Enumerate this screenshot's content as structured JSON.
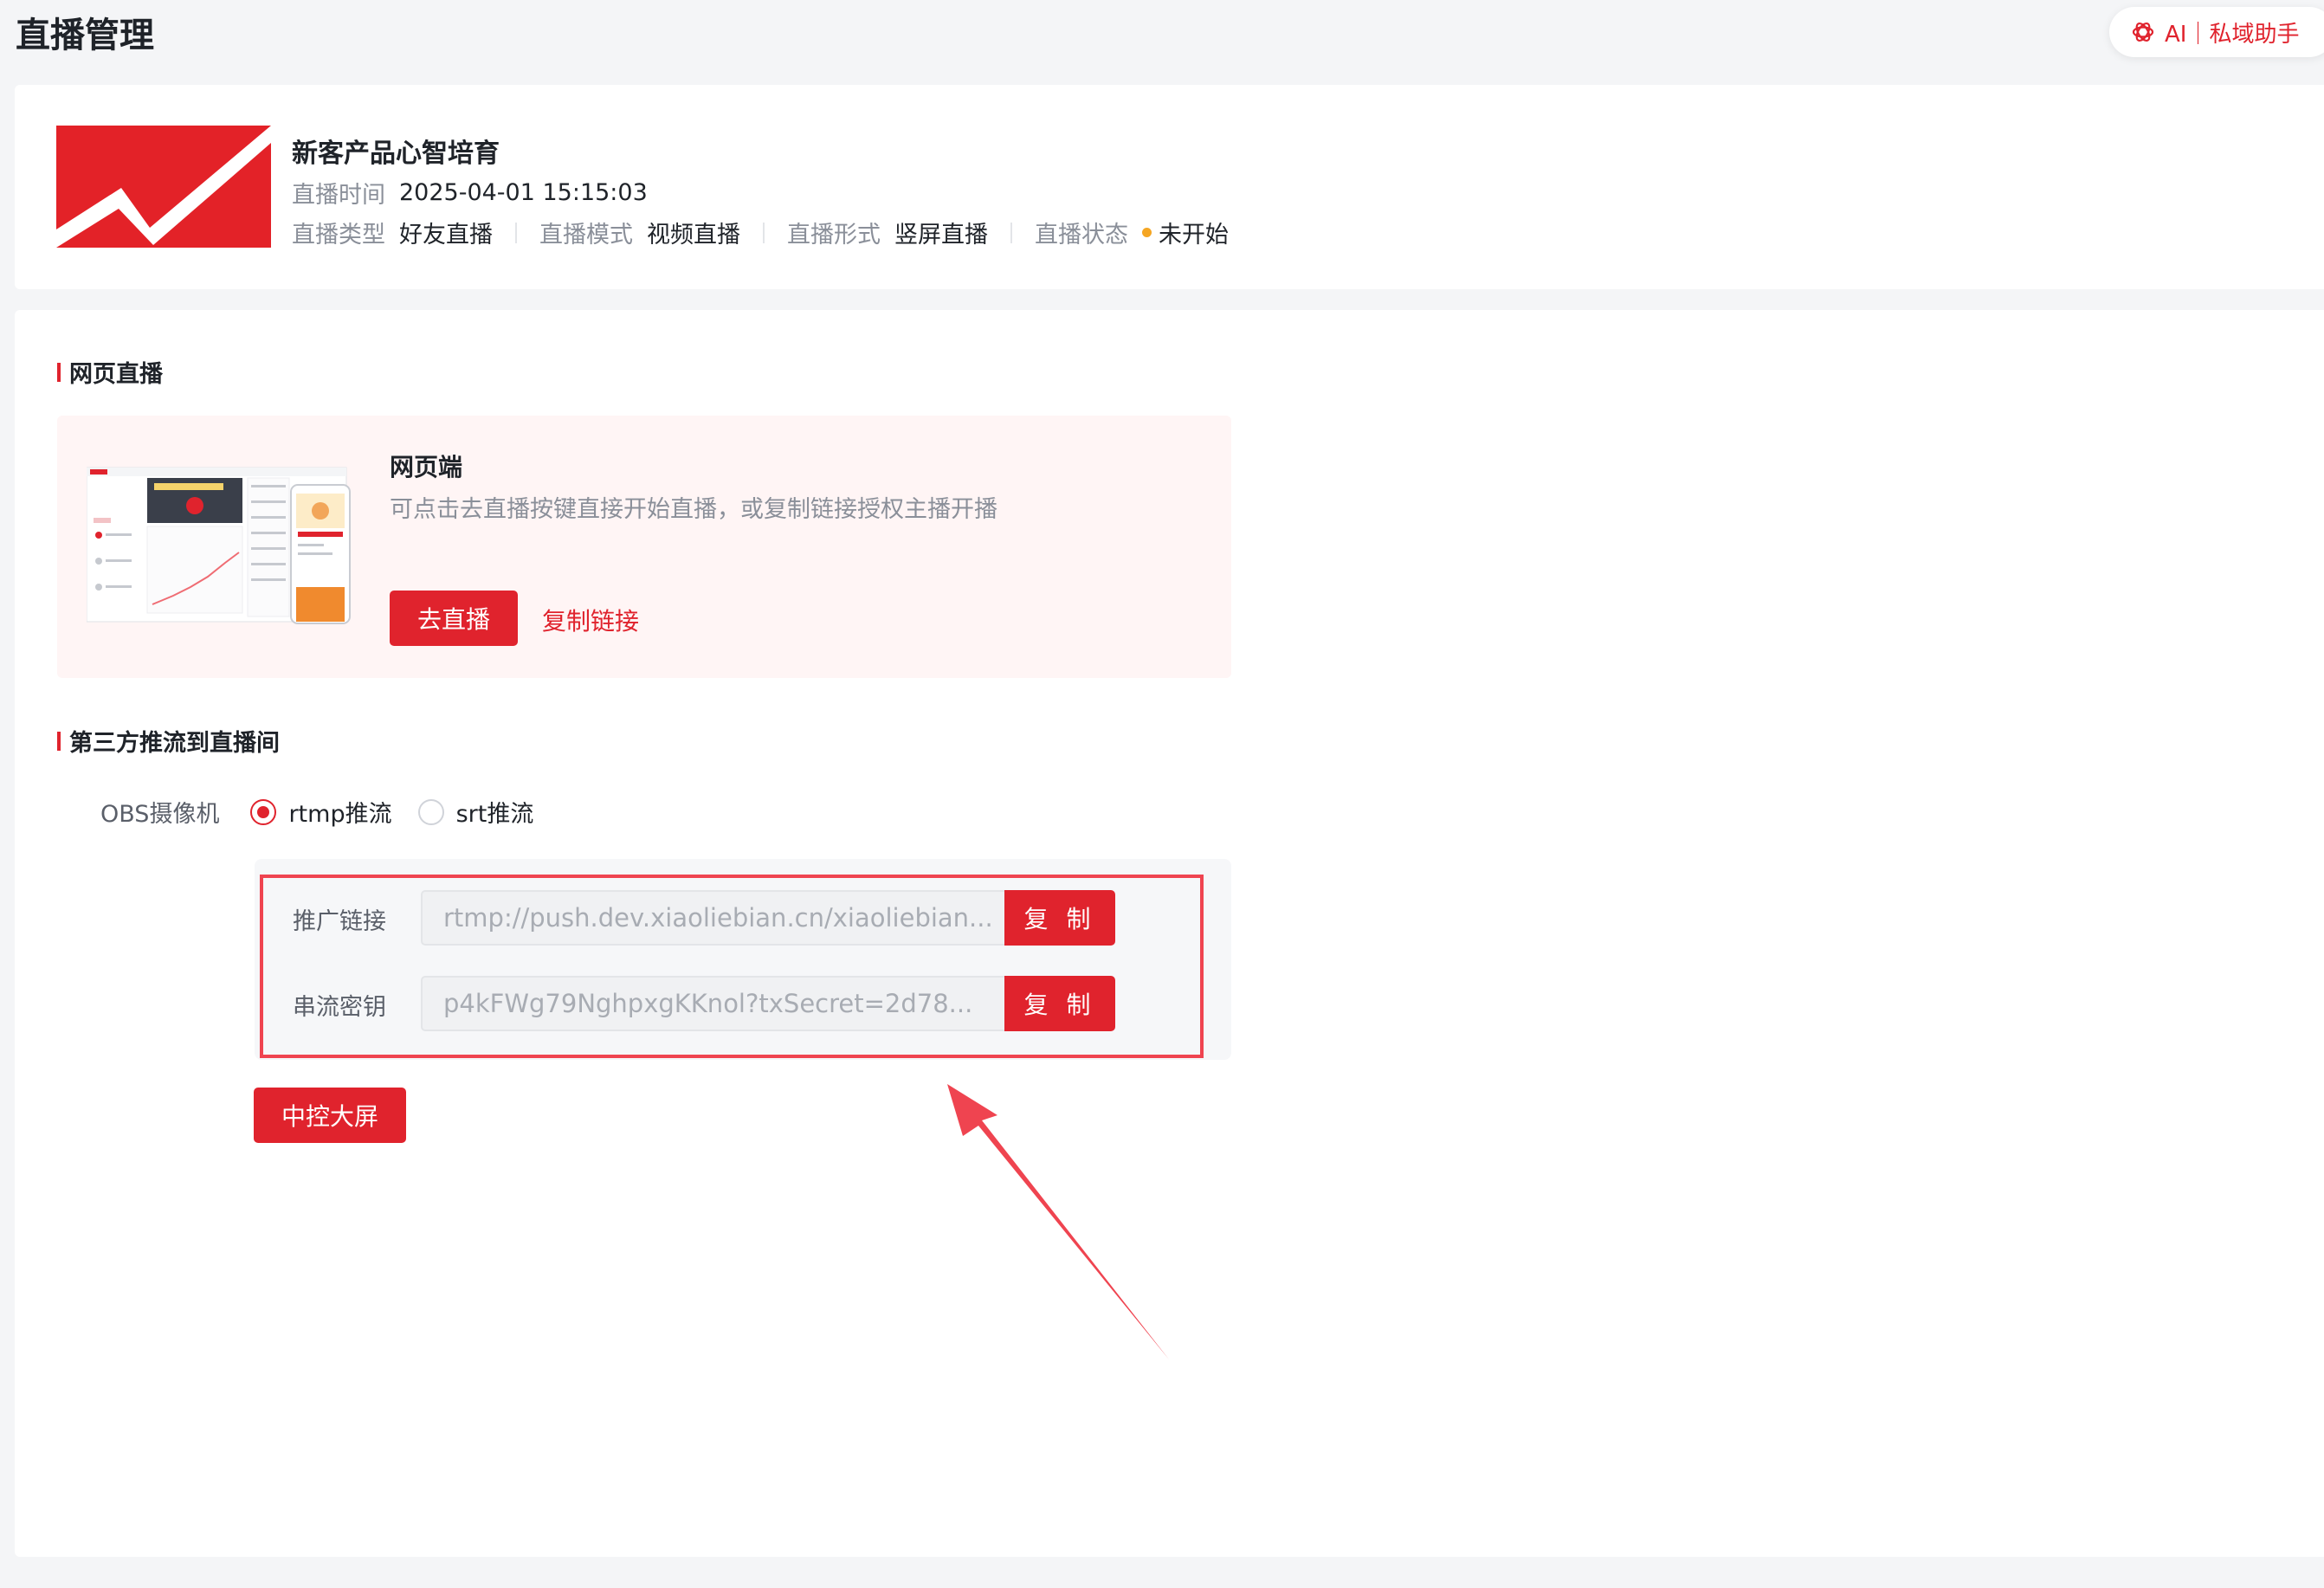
{
  "header": {
    "title": "直播管理",
    "ai_assistant_label": "AI｜私域助手"
  },
  "live_info": {
    "name": "新客产品心智培育",
    "time_label": "直播时间",
    "time_value": "2025-04-01 15:15:03",
    "type_label": "直播类型",
    "type_value": "好友直播",
    "mode_label": "直播模式",
    "mode_value": "视频直播",
    "format_label": "直播形式",
    "format_value": "竖屏直播",
    "status_label": "直播状态",
    "status_value": "未开始",
    "status_color": "#f5a623"
  },
  "web_live": {
    "section_title": "网页直播",
    "card_title": "网页端",
    "card_desc": "可点击去直播按键直接开始直播，或复制链接授权主播开播",
    "go_live_label": "去直播",
    "copy_link_label": "复制链接"
  },
  "third_party": {
    "section_title": "第三方推流到直播间",
    "device_label": "OBS摄像机",
    "options": [
      "rtmp推流",
      "srt推流"
    ],
    "selected": "rtmp推流",
    "push_url_label": "推广链接",
    "push_url_value": "rtmp://push.dev.xiaoliebian.cn/xiaoliebian...",
    "stream_key_label": "串流密钥",
    "stream_key_value": "p4kFWg79NghpxgKKnol?txSecret=2d78...",
    "copy_label": "复 制",
    "center_screen_label": "中控大屏"
  },
  "colors": {
    "accent": "#e0232d",
    "annotation": "#ef4450"
  }
}
